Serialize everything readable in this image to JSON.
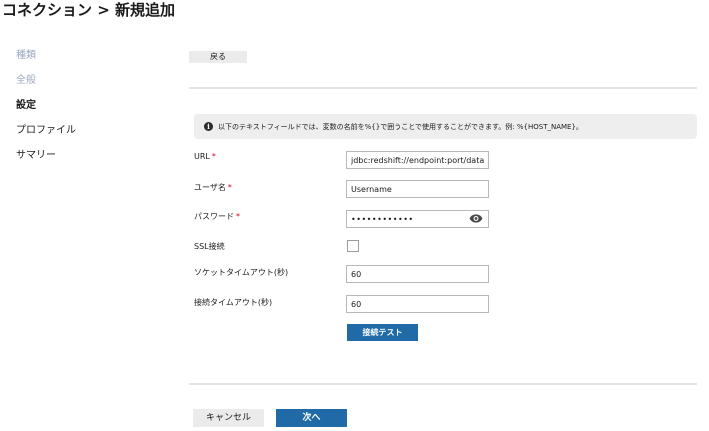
{
  "header": {
    "title": "コネクション > 新規追加"
  },
  "sidebar": {
    "items": [
      {
        "label": "種類"
      },
      {
        "label": "全般"
      },
      {
        "label": "設定"
      },
      {
        "label": "プロファイル"
      },
      {
        "label": "サマリー"
      }
    ]
  },
  "toolbar": {
    "back_label": "戻る"
  },
  "info": {
    "text": "以下のテキストフィールドでは、変数の名前を%{}で囲うことで使用することができます。例: %{HOST_NAME}。"
  },
  "form": {
    "url": {
      "label": "URL",
      "value": "jdbc:redshift://endpoint:port/database"
    },
    "username": {
      "label": "ユーザ名",
      "value": "Username"
    },
    "password": {
      "label": "パスワード",
      "value": "••••••••••••"
    },
    "ssl": {
      "label": "SSL接続",
      "checked": false
    },
    "socket_timeout": {
      "label": "ソケットタイムアウト(秒)",
      "value": "60"
    },
    "connect_timeout": {
      "label": "接続タイムアウト(秒)",
      "value": "60"
    },
    "required_mark": "*",
    "test_button": "接続テスト"
  },
  "footer": {
    "cancel_label": "キャンセル",
    "next_label": "次へ"
  },
  "colors": {
    "primary": "#1f6aa7",
    "required": "#d0021b",
    "muted_nav": "#9aa9c0",
    "info_bg": "#eeeeee"
  }
}
